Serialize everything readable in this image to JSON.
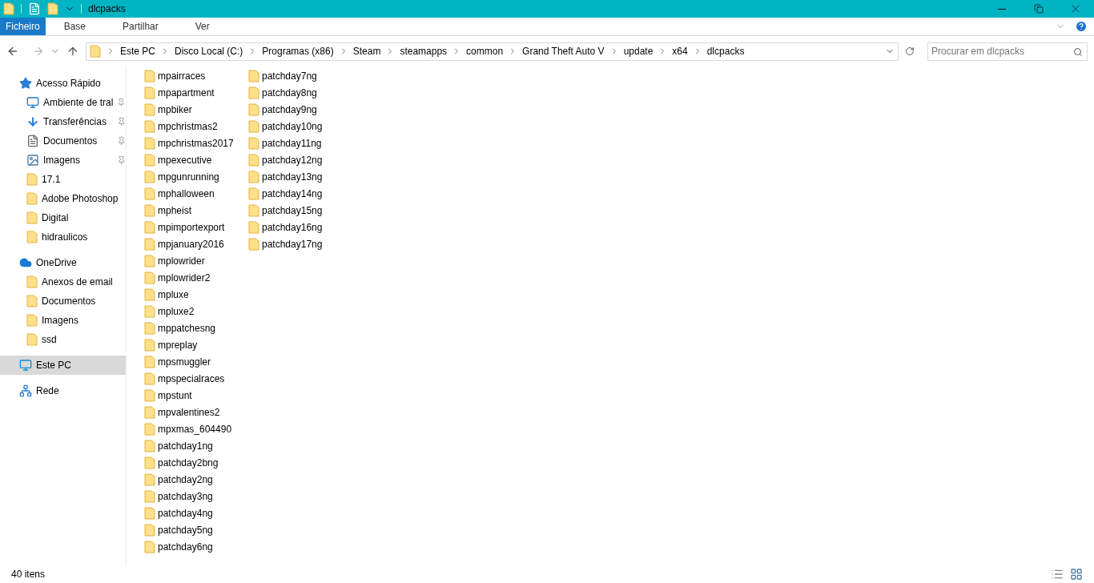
{
  "window": {
    "title": "dlcpacks"
  },
  "ribbon_tabs": [
    {
      "label": "Ficheiro",
      "selected": true
    },
    {
      "label": "Base",
      "selected": false
    },
    {
      "label": "Partilhar",
      "selected": false
    },
    {
      "label": "Ver",
      "selected": false
    }
  ],
  "breadcrumb": [
    "Este PC",
    "Disco Local (C:)",
    "Programas (x86)",
    "Steam",
    "steamapps",
    "common",
    "Grand Theft Auto V",
    "update",
    "x64",
    "dlcpacks"
  ],
  "search": {
    "placeholder": "Procurar em dlcpacks"
  },
  "sidebar": {
    "items": [
      {
        "kind": "star",
        "label": "Acesso Rápido",
        "pinned": false,
        "selected": false,
        "section": true
      },
      {
        "kind": "desktop",
        "label": "Ambiente de tral",
        "pinned": true,
        "selected": false,
        "section": false
      },
      {
        "kind": "download",
        "label": "Transferências",
        "pinned": true,
        "selected": false,
        "section": false
      },
      {
        "kind": "document",
        "label": "Documentos",
        "pinned": true,
        "selected": false,
        "section": false
      },
      {
        "kind": "image",
        "label": "Imagens",
        "pinned": true,
        "selected": false,
        "section": false
      },
      {
        "kind": "folder",
        "label": "17.1",
        "pinned": false,
        "selected": false,
        "section": false
      },
      {
        "kind": "folder",
        "label": "Adobe Photoshop",
        "pinned": false,
        "selected": false,
        "section": false
      },
      {
        "kind": "folder",
        "label": "Digital",
        "pinned": false,
        "selected": false,
        "section": false
      },
      {
        "kind": "folder",
        "label": "hidraulicos",
        "pinned": false,
        "selected": false,
        "section": false
      },
      {
        "kind": "cloud",
        "label": "OneDrive",
        "pinned": false,
        "selected": false,
        "section": true
      },
      {
        "kind": "folder",
        "label": "Anexos de email",
        "pinned": false,
        "selected": false,
        "section": false
      },
      {
        "kind": "folder",
        "label": "Documentos",
        "pinned": false,
        "selected": false,
        "section": false
      },
      {
        "kind": "folder",
        "label": "Imagens",
        "pinned": false,
        "selected": false,
        "section": false
      },
      {
        "kind": "folder",
        "label": "ssd",
        "pinned": false,
        "selected": false,
        "section": false
      },
      {
        "kind": "computer",
        "label": "Este PC",
        "pinned": false,
        "selected": true,
        "section": true
      },
      {
        "kind": "network",
        "label": "Rede",
        "pinned": false,
        "selected": false,
        "section": true
      }
    ]
  },
  "files": [
    "mpairraces",
    "mpapartment",
    "mpbiker",
    "mpchristmas2",
    "mpchristmas2017",
    "mpexecutive",
    "mpgunrunning",
    "mphalloween",
    "mpheist",
    "mpimportexport",
    "mpjanuary2016",
    "mplowrider",
    "mplowrider2",
    "mpluxe",
    "mpluxe2",
    "mppatchesng",
    "mpreplay",
    "mpsmuggler",
    "mpspecialraces",
    "mpstunt",
    "mpvalentines2",
    "mpxmas_604490",
    "patchday1ng",
    "patchday2bng",
    "patchday2ng",
    "patchday3ng",
    "patchday4ng",
    "patchday5ng",
    "patchday6ng",
    "patchday7ng",
    "patchday8ng",
    "patchday9ng",
    "patchday10ng",
    "patchday11ng",
    "patchday12ng",
    "patchday13ng",
    "patchday14ng",
    "patchday15ng",
    "patchday16ng",
    "patchday17ng"
  ],
  "status_bar": {
    "count": "40 itens"
  }
}
